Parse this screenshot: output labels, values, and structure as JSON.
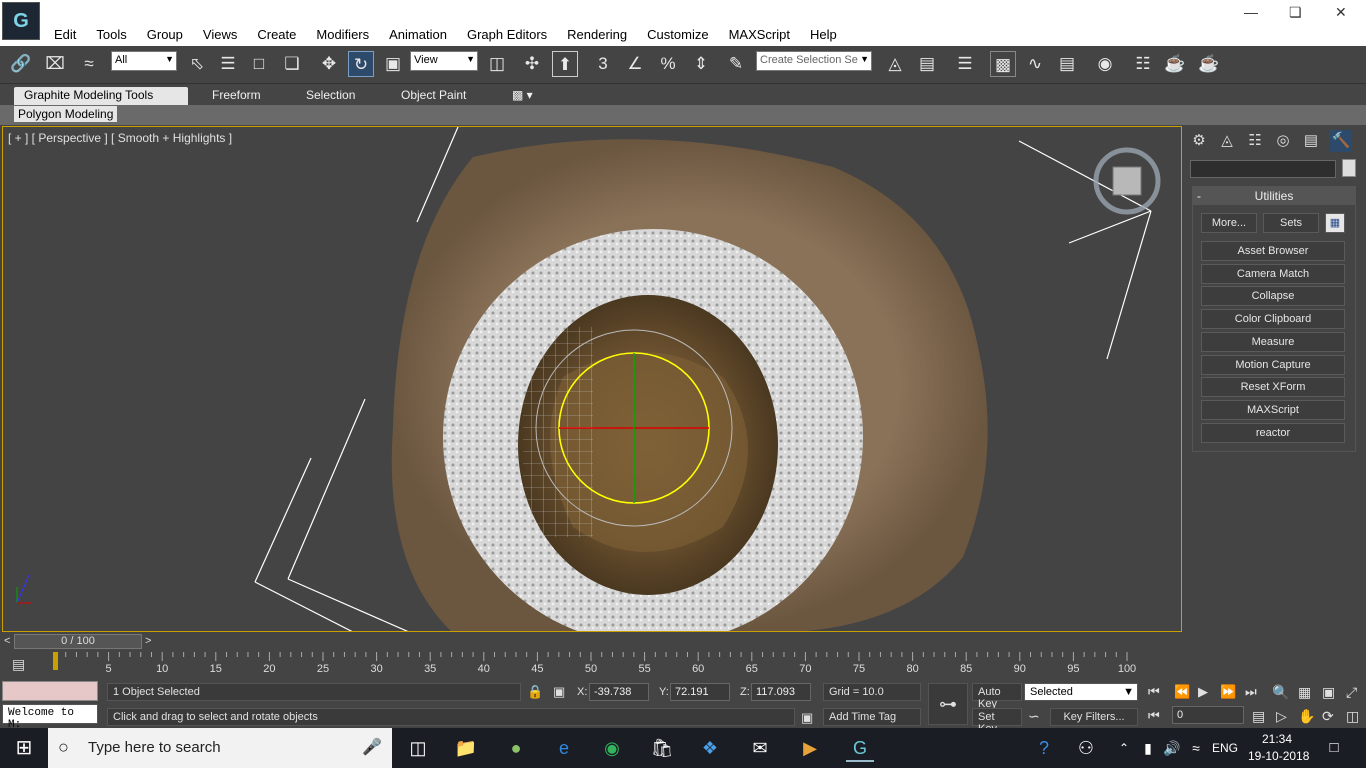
{
  "menu": {
    "items": [
      "Edit",
      "Tools",
      "Group",
      "Views",
      "Create",
      "Modifiers",
      "Animation",
      "Graph Editors",
      "Rendering",
      "Customize",
      "MAXScript",
      "Help"
    ]
  },
  "toolbar": {
    "selection_filter": "All",
    "ref_coord": "View",
    "named_sel": "Create Selection Se"
  },
  "ribbon": {
    "tabs": [
      "Graphite Modeling Tools",
      "Freeform",
      "Selection",
      "Object Paint"
    ],
    "panel_label": "Polygon Modeling"
  },
  "viewport": {
    "label": "[ + ] [ Perspective ] [ Smooth + Highlights ]"
  },
  "command_panel": {
    "rollout_title": "Utilities",
    "more_label": "More...",
    "sets_label": "Sets",
    "utilities": [
      "Asset Browser",
      "Camera Match",
      "Collapse",
      "Color Clipboard",
      "Measure",
      "Motion Capture",
      "Reset XForm",
      "MAXScript",
      "reactor"
    ]
  },
  "timeline": {
    "slider_label": "0 / 100",
    "ticks": [
      "5",
      "10",
      "15",
      "20",
      "25",
      "30",
      "35",
      "40",
      "45",
      "50",
      "55",
      "60",
      "65",
      "70",
      "75",
      "80",
      "85",
      "90",
      "95",
      "100"
    ]
  },
  "status": {
    "selection_text": "1 Object Selected",
    "prompt": "Click and drag to select and rotate objects",
    "listener": "Welcome to M:",
    "x_label": "X:",
    "x_value": "-39.738",
    "y_label": "Y:",
    "y_value": "72.191",
    "z_label": "Z:",
    "z_value": "117.093",
    "grid": "Grid = 10.0",
    "add_time_tag": "Add Time Tag",
    "auto_key": "Auto Key",
    "set_key": "Set Key",
    "key_mode": "Selected",
    "key_filters": "Key Filters...",
    "frame": "0"
  },
  "taskbar": {
    "search_placeholder": "Type here to search",
    "lang": "ENG",
    "time": "21:34",
    "date": "19-10-2018"
  }
}
